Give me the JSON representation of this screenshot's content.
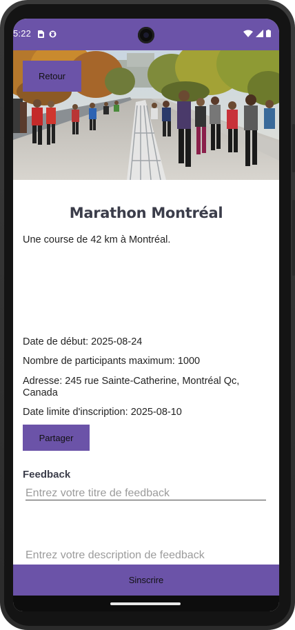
{
  "status_bar": {
    "time": "5:22",
    "left_icons": [
      "sim-card-icon",
      "app-notification-icon"
    ],
    "right_icons": [
      "wifi-icon",
      "cell-signal-icon",
      "battery-icon"
    ],
    "accent": "#6b53a8"
  },
  "hero": {
    "image": "marathon-runners-photo",
    "back_label": "Retour"
  },
  "event": {
    "title": "Marathon Montréal",
    "description": "Une course de 42 km à Montréal.",
    "start_date": "Date de début: 2025-08-24",
    "max_participants": "Nombre de participants maximum: 1000",
    "address": "Adresse: 245 rue Sainte-Catherine, Montréal Qc, Canada",
    "registration_deadline": "Date limite d'inscription: 2025-08-10",
    "share_label": "Partager"
  },
  "feedback": {
    "heading": "Feedback",
    "title_placeholder": "Entrez votre titre de feedback",
    "title_value": "",
    "description_placeholder": "Entrez votre description de feedback",
    "description_value": ""
  },
  "footer": {
    "signup_label": "Sinscrire"
  },
  "colors": {
    "primary": "#6b53a8",
    "title_text": "#3b3d4a",
    "body_text": "#232323",
    "placeholder": "#9b9b9b"
  }
}
